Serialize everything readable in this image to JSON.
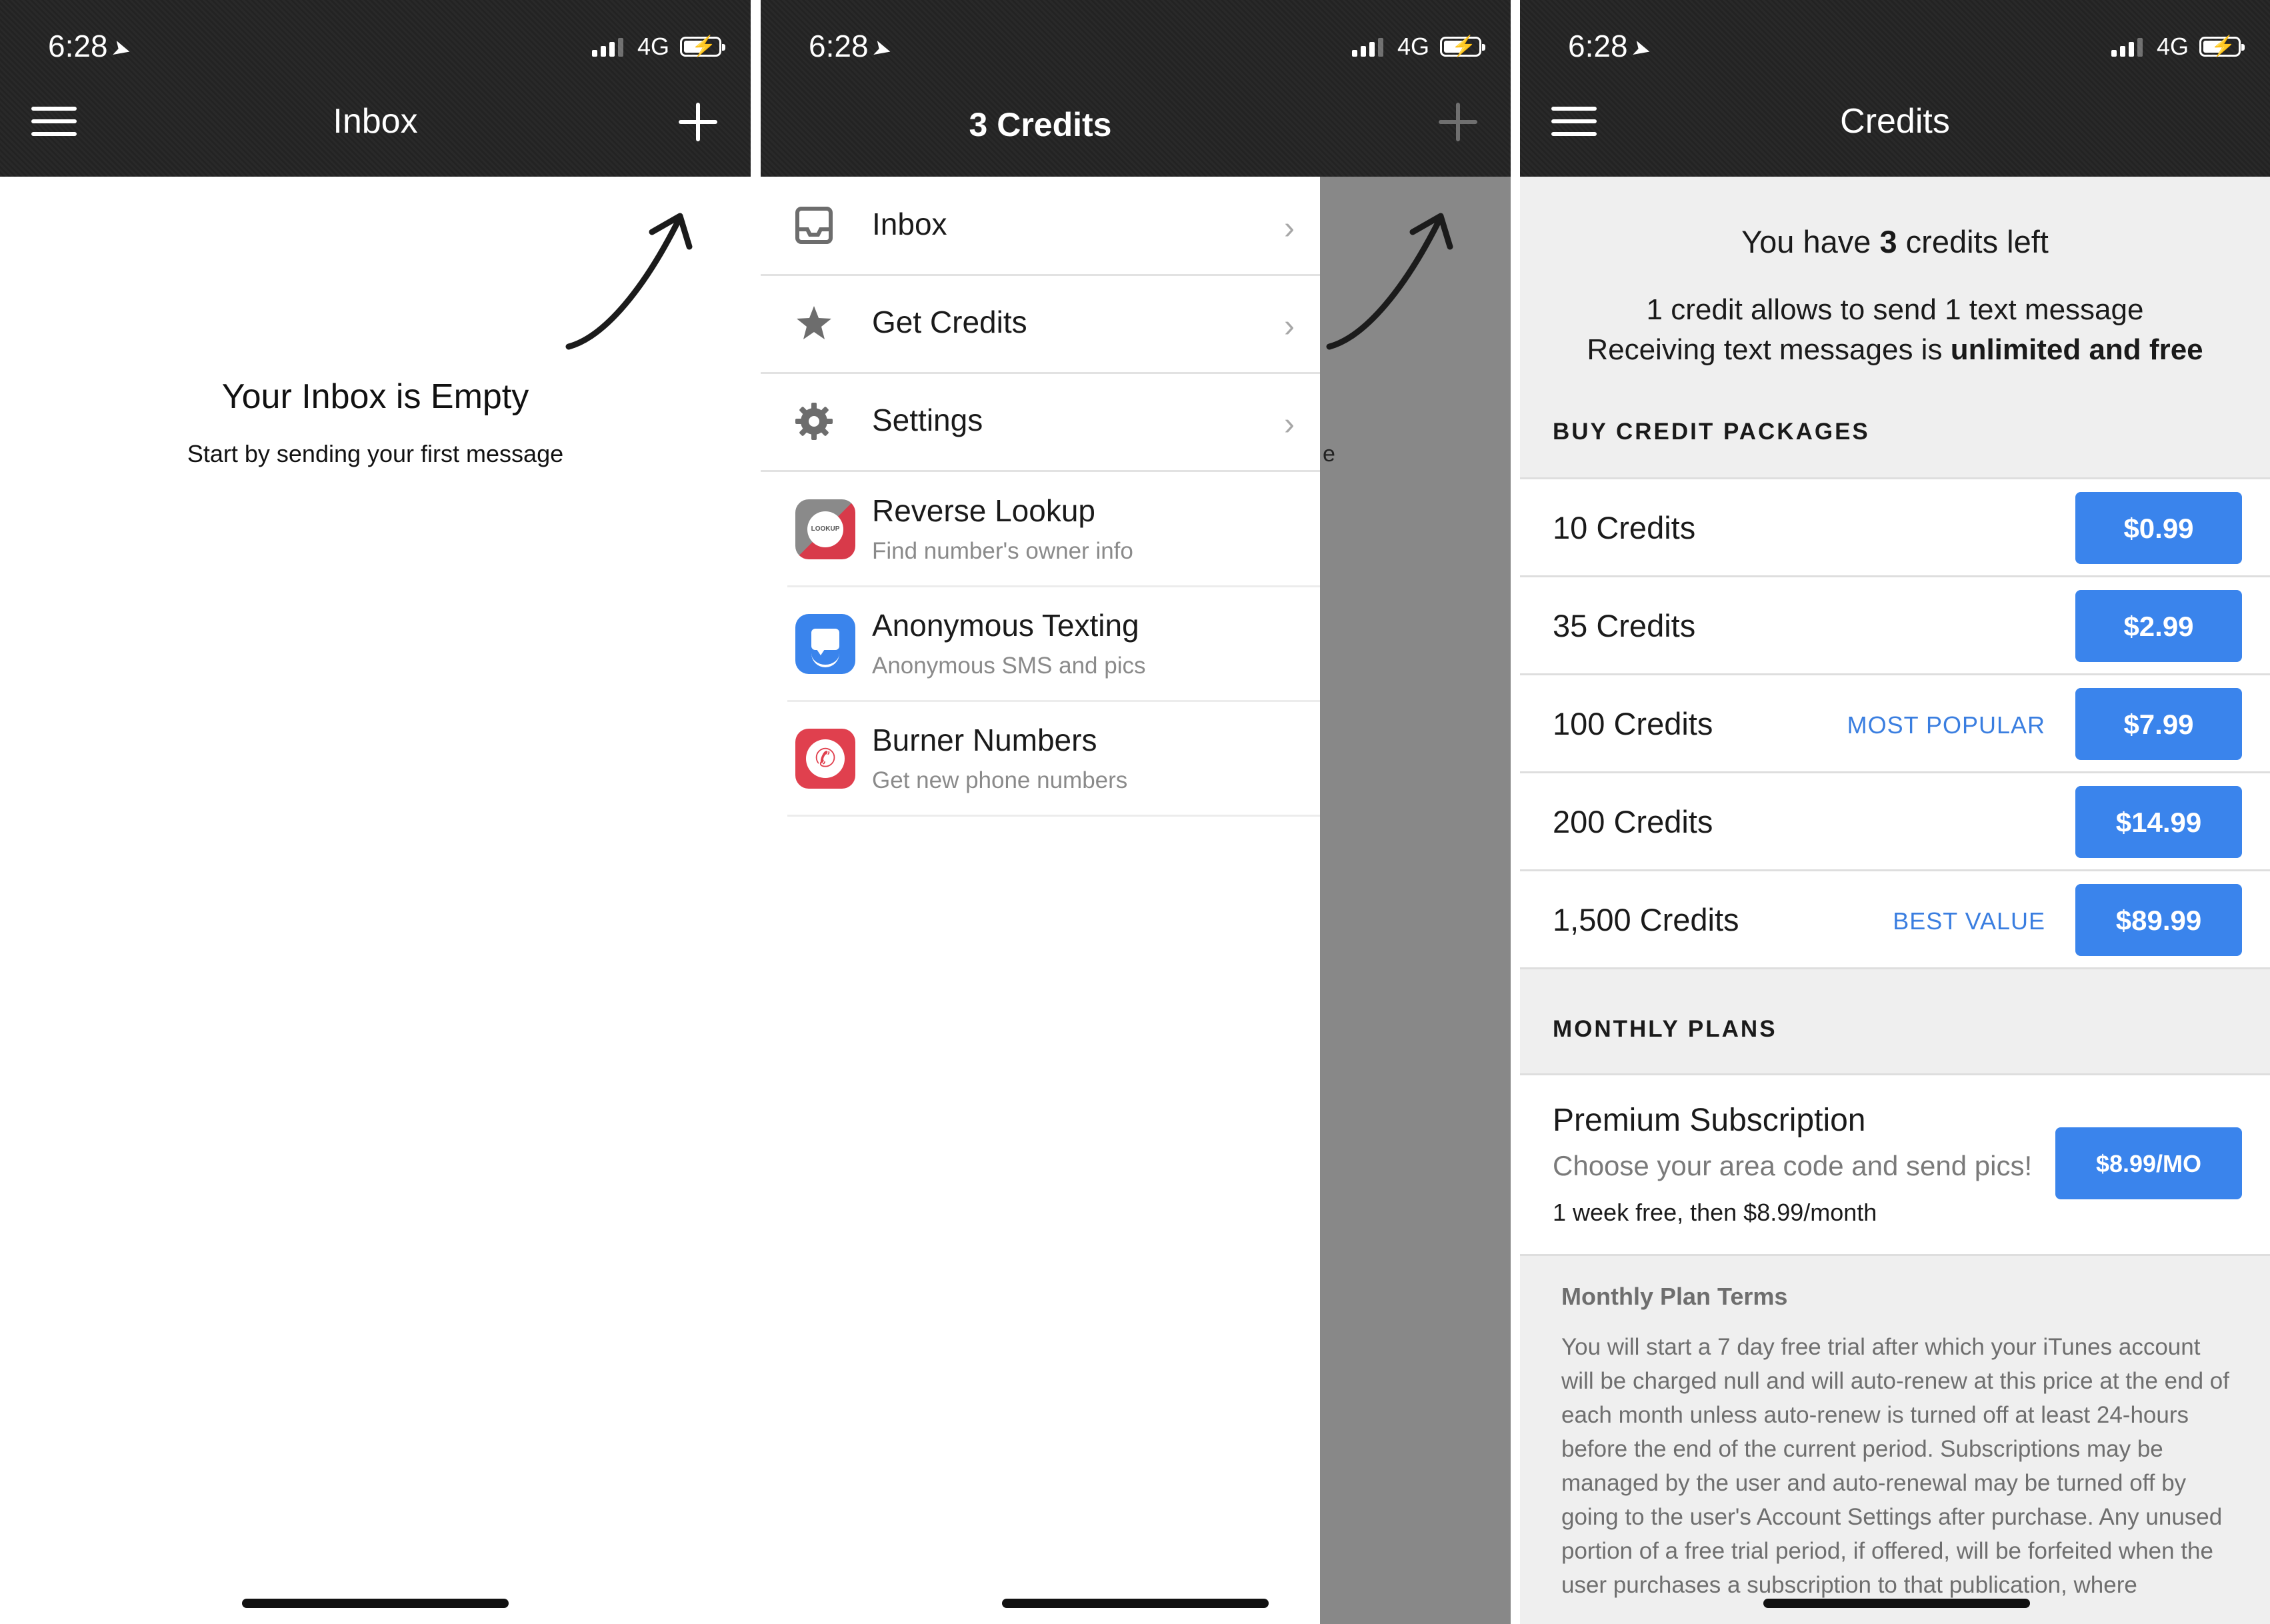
{
  "status_bar": {
    "time": "6:28",
    "network": "4G"
  },
  "panel_inbox": {
    "title": "Inbox",
    "empty_title": "Your Inbox is Empty",
    "empty_subtitle": "Start by sending your first message"
  },
  "panel_menu": {
    "title": "3 Credits",
    "items": [
      {
        "label": "Inbox",
        "icon": "inbox-icon"
      },
      {
        "label": "Get Credits",
        "icon": "star-icon"
      },
      {
        "label": "Settings",
        "icon": "gear-icon"
      }
    ],
    "apps": [
      {
        "name": "Reverse Lookup",
        "desc": "Find number's owner info",
        "icon_text": "LOOKUP",
        "color": "#d83a4a"
      },
      {
        "name": "Anonymous Texting",
        "desc": "Anonymous SMS and pics",
        "color": "#3a84ec"
      },
      {
        "name": "Burner Numbers",
        "desc": "Get new phone numbers",
        "color": "#e0404e"
      }
    ],
    "behind_text": "e"
  },
  "panel_credits": {
    "title": "Credits",
    "have_prefix": "You have ",
    "have_count": "3",
    "have_suffix": " credits left",
    "info_line1": "1 credit allows to send 1 text message",
    "info_line2_prefix": "Receiving text messages is ",
    "info_line2_bold": "unlimited and free",
    "packages_header": "BUY CREDIT PACKAGES",
    "packages": [
      {
        "name": "10 Credits",
        "tag": "",
        "price": "$0.99"
      },
      {
        "name": "35 Credits",
        "tag": "",
        "price": "$2.99"
      },
      {
        "name": "100 Credits",
        "tag": "MOST POPULAR",
        "price": "$7.99"
      },
      {
        "name": "200 Credits",
        "tag": "",
        "price": "$14.99"
      },
      {
        "name": "1,500 Credits",
        "tag": "BEST VALUE",
        "price": "$89.99"
      }
    ],
    "monthly_header": "MONTHLY PLANS",
    "subscription": {
      "name": "Premium Subscription",
      "desc": "Choose your area code and send pics!",
      "trial": "1 week free, then $8.99/month",
      "price": "$8.99/MO"
    },
    "terms_title": "Monthly Plan Terms",
    "terms_text": "You will start a 7 day free trial after which your iTunes account will be charged null and will auto-renew at this price at the end of each month unless auto-renew is turned off at least 24-hours before the end of the current period. Subscriptions may be managed by the user and auto-renewal may be turned off by going to the user's Account Settings after purchase. Any unused portion of a free trial period, if offered, will be forfeited when the user purchases a subscription to that publication, where"
  },
  "colors": {
    "header_bg": "#242424",
    "accent_blue": "#3a84ec",
    "tag_blue": "#3a7ee0",
    "overlay_gray": "#888888",
    "credits_bg": "#efefef"
  }
}
